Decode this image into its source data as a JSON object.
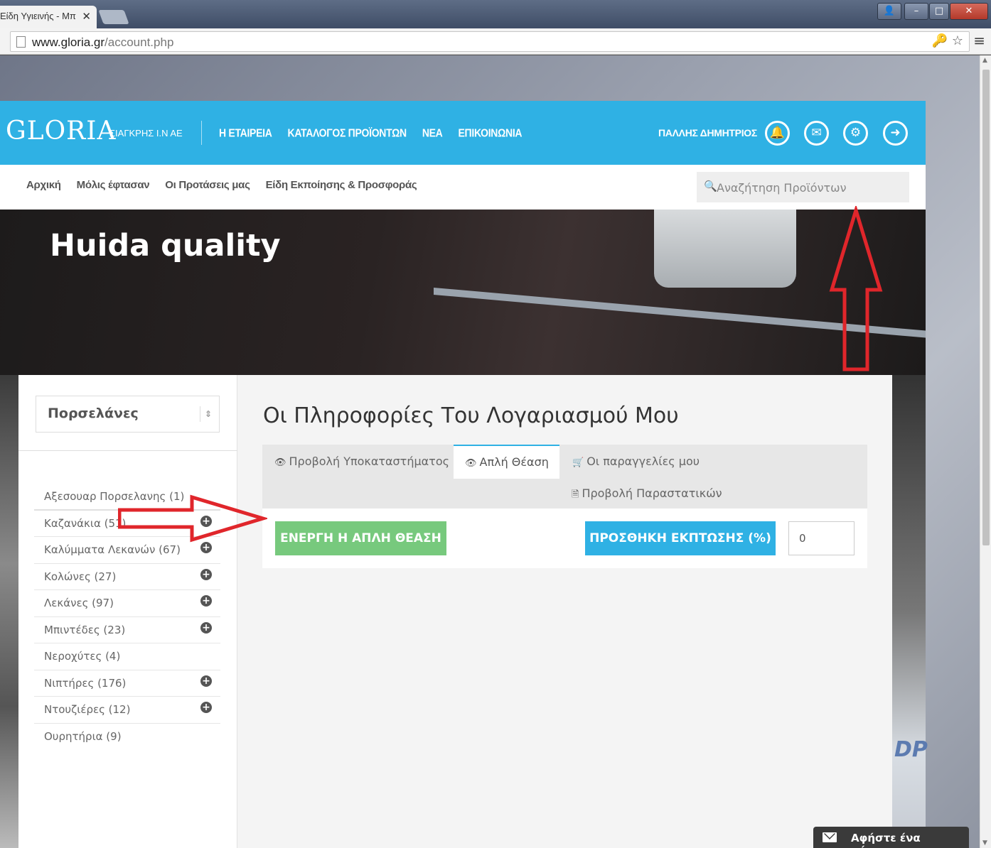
{
  "browser": {
    "tab_title": "Είδη Υγιεινής - Μπ",
    "tab_close": "✕",
    "url_domain": "www.gloria.gr",
    "url_path": "/account.php",
    "win_user": "👤",
    "win_min": "–",
    "win_max": "□",
    "win_close": "✕",
    "url_icons": "🔑 ☆",
    "menu_icon": "≡"
  },
  "header": {
    "logo": "GLORIA",
    "logo_sub": "ΣΙΑΓΚΡΗΣ Ι.Ν ΑΕ",
    "nav": [
      "Η ΕΤΑΙΡΕΙΑ",
      "ΚΑΤΑΛΟΓΟΣ ΠΡΟΪΟΝΤΩΝ",
      "ΝΕΑ",
      "ΕΠΙΚΟΙΝΩΝΙΑ"
    ],
    "user_name": "ΠΑΛΛΗΣ ΔΗΜΗΤΡΙΟΣ",
    "icons": {
      "bell": "🔔",
      "mail": "✉",
      "gear": "⚙",
      "logout": "➜"
    }
  },
  "subnav": {
    "links": [
      "Αρχική",
      "Μόλις έφτασαν",
      "Οι Προτάσεις μας",
      "Είδη Εκποίησης & Προσφοράς"
    ],
    "search_placeholder": "Αναζήτηση Προϊόντων",
    "search_icon": "🔍"
  },
  "hero": {
    "title": "Huida quality"
  },
  "sidebar": {
    "selected_category": "Πορσελάνες",
    "select_arrow": "⇕",
    "categories": [
      {
        "label": "Αξεσουαρ Πορσελανης (1)",
        "expandable": false
      },
      {
        "label": "Καζανάκια (51)",
        "expandable": true
      },
      {
        "label": "Καλύμματα Λεκανών (67)",
        "expandable": true
      },
      {
        "label": "Κολώνες (27)",
        "expandable": true
      },
      {
        "label": "Λεκάνες (97)",
        "expandable": true
      },
      {
        "label": "Μπιντέδες (23)",
        "expandable": true
      },
      {
        "label": "Νεροχύτες (4)",
        "expandable": false
      },
      {
        "label": "Νιπτήρες (176)",
        "expandable": true
      },
      {
        "label": "Ντουζιέρες (12)",
        "expandable": true
      },
      {
        "label": "Ουρητήρια (9)",
        "expandable": false
      }
    ],
    "plus": "+"
  },
  "main": {
    "title": "Οι Πληροφορίες Του Λογαριασμού Μου",
    "tabs": {
      "branch": "Προβολή Υποκαταστήματος",
      "simple": "Απλή Θέαση",
      "orders": "Οι παραγγελίες μου",
      "docs": "Προβολή Παραστατικών"
    },
    "tab_icons": {
      "eye": "👁",
      "cart": "🛒",
      "doc": "🗎"
    },
    "active_button": "ΕΝΕΡΓΗ Η ΑΠΛΗ ΘΕΑΣΗ",
    "discount_button": "ΠΡΟΣΘΗΚΗ ΕΚΠΤΩΣΗΣ (%)",
    "discount_value": "0"
  },
  "chat": {
    "label": "Αφήστε ένα μήνυμα"
  },
  "colors": {
    "brand": "#2fb1e4",
    "green": "#77c97d",
    "arrow": "#e0262b"
  }
}
